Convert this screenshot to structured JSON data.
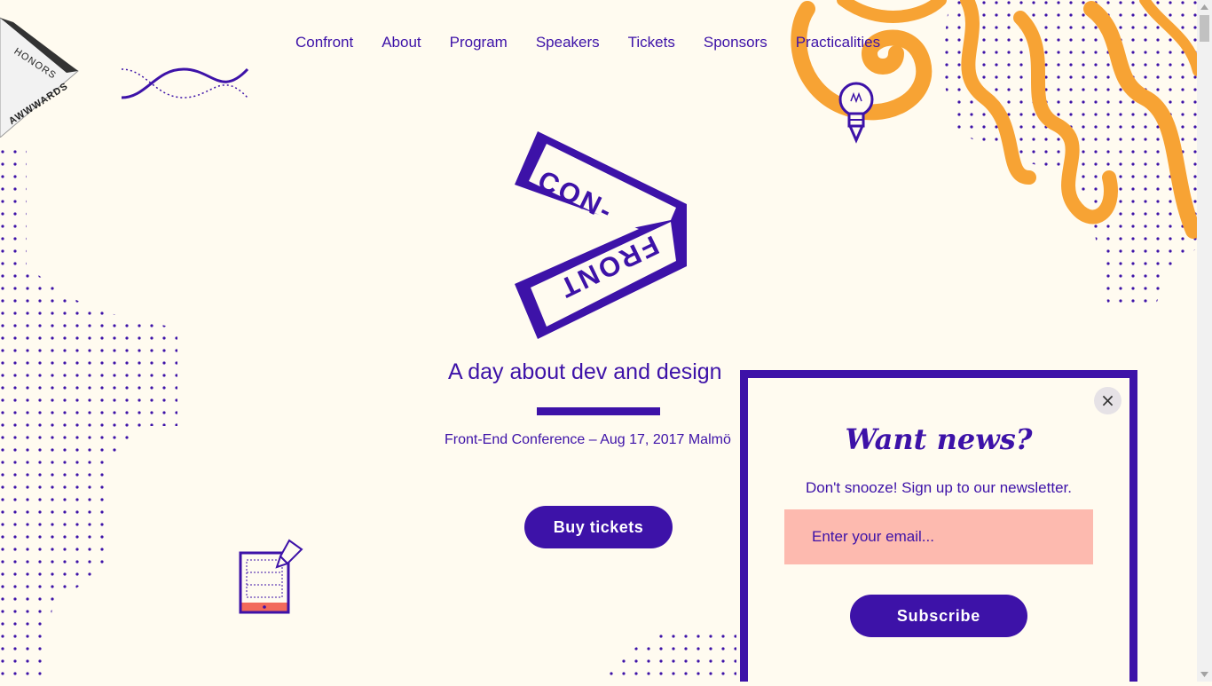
{
  "nav": {
    "items": [
      {
        "label": "Confront"
      },
      {
        "label": "About"
      },
      {
        "label": "Program"
      },
      {
        "label": "Speakers"
      },
      {
        "label": "Tickets"
      },
      {
        "label": "Sponsors"
      },
      {
        "label": "Practicalities"
      }
    ]
  },
  "badge": {
    "line1": "HONORS",
    "line2": "AWWWARDS"
  },
  "logo": {
    "top": "CON-",
    "bottom": "FRONT"
  },
  "hero": {
    "tagline": "A day about dev and design",
    "subline": "Front-End Conference – Aug 17, 2017 Malmö",
    "cta": "Buy tickets"
  },
  "modal": {
    "close": "×",
    "title": "Want news?",
    "subtitle": "Don't snooze! Sign up to our newsletter.",
    "email_placeholder": "Enter your email...",
    "email_value": "",
    "submit": "Subscribe"
  },
  "colors": {
    "brand": "#3d12a8",
    "background": "#fffbf0",
    "accent_orange": "#f7a334",
    "input_pink": "#fdbaaf",
    "tablet_red": "#f26a5b"
  },
  "icons": [
    "lightbulb-icon",
    "tablet-pen-icon",
    "close-icon",
    "wave-decoration",
    "dots-decoration"
  ]
}
